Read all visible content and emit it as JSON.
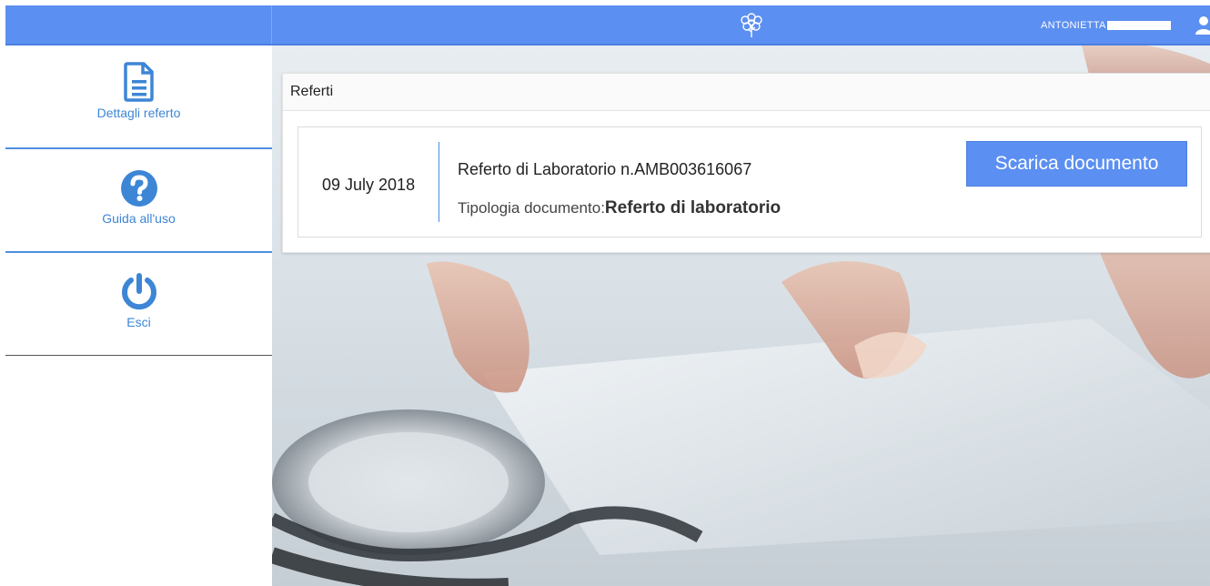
{
  "header": {
    "user_name": "ANTONIETTA",
    "logo_icon": "tree-logo-icon",
    "user_icon": "user-icon"
  },
  "sidebar": {
    "items": [
      {
        "label": "Dettagli referto",
        "icon": "document-icon"
      },
      {
        "label": "Guida all'uso",
        "icon": "question-icon"
      },
      {
        "label": "Esci",
        "icon": "power-icon"
      }
    ]
  },
  "panel": {
    "title": "Referti",
    "report": {
      "date": "09 July 2018",
      "title": "Referto di Laboratorio n.AMB003616067",
      "type_label": "Tipologia documento:",
      "type_value": "Referto di laboratorio",
      "download_label": "Scarica documento"
    }
  },
  "colors": {
    "accent": "#5b8ff1",
    "link": "#3d86d6"
  }
}
